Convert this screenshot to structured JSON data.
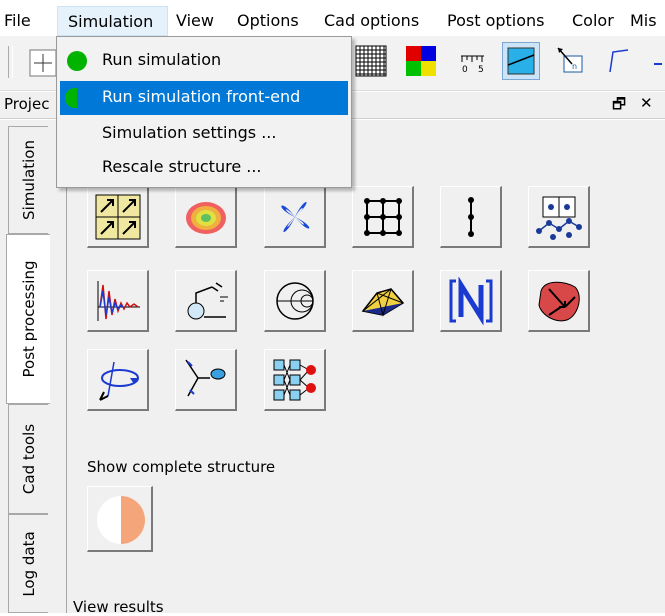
{
  "menubar": {
    "items": [
      "File",
      "Simulation",
      "View",
      "Options",
      "Cad options",
      "Post options",
      "Color",
      "Mis"
    ]
  },
  "dropdown": {
    "items": [
      {
        "label": "Run simulation",
        "icon": "green-circle-icon"
      },
      {
        "label": "Run simulation front-end",
        "icon": "green-half-circle-icon",
        "highlighted": true
      },
      {
        "label": "Simulation settings ..."
      },
      {
        "label": "Rescale structure ..."
      }
    ]
  },
  "panel": {
    "title": "Projec",
    "restore_symbol": "🗗",
    "close_symbol": "✕"
  },
  "side_tabs": [
    "Simulation",
    "Post processing",
    "Cad tools",
    "Log data"
  ],
  "content": {
    "show_complete_label": "Show complete structure",
    "view_results_label": "View results"
  },
  "colors": {
    "highlight": "#0078d7",
    "menu_active": "#e5f1fb",
    "green": "#00b300",
    "half_circle_orange": "#f4a57a"
  }
}
